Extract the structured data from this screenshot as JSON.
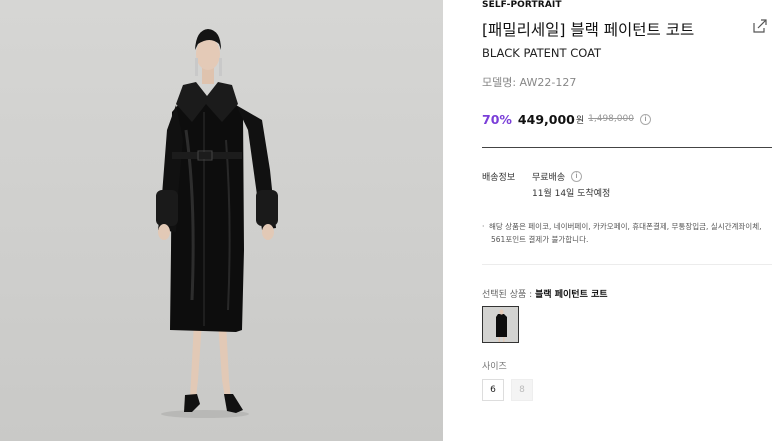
{
  "product": {
    "brand": "SELF-PORTRAIT",
    "title": "[패밀리세일] 블랙 페이턴트 코트",
    "subtitle": "BLACK PATENT COAT",
    "model_label": "모델명: AW22-127",
    "discount": "70%",
    "price": "449,000",
    "currency": "원",
    "original_price": "1,498,000"
  },
  "shipping": {
    "label": "배송정보",
    "value": "무료배송",
    "arrival": "11월 14일 도착예정"
  },
  "notice": {
    "bullet": "·",
    "line1": "해당 상품은 페이코, 네이버페이, 카카오페이, 휴대폰결제, 무통장입금, 실시간계좌이체,",
    "line2": "561포인트 결제가 불가합니다."
  },
  "selection": {
    "label": "선택된 상품 :",
    "value": "블랙 페이턴트 코트"
  },
  "sizes": {
    "label": "사이즈",
    "options": [
      {
        "label": "6",
        "available": true
      },
      {
        "label": "8",
        "available": false
      }
    ]
  },
  "icons": {
    "share": "share-icon",
    "info": "info-icon",
    "info_glyph": "i"
  },
  "colors": {
    "accent": "#7a3ed8",
    "coat": "#0d0d0d",
    "background": "#d1d1cf"
  }
}
